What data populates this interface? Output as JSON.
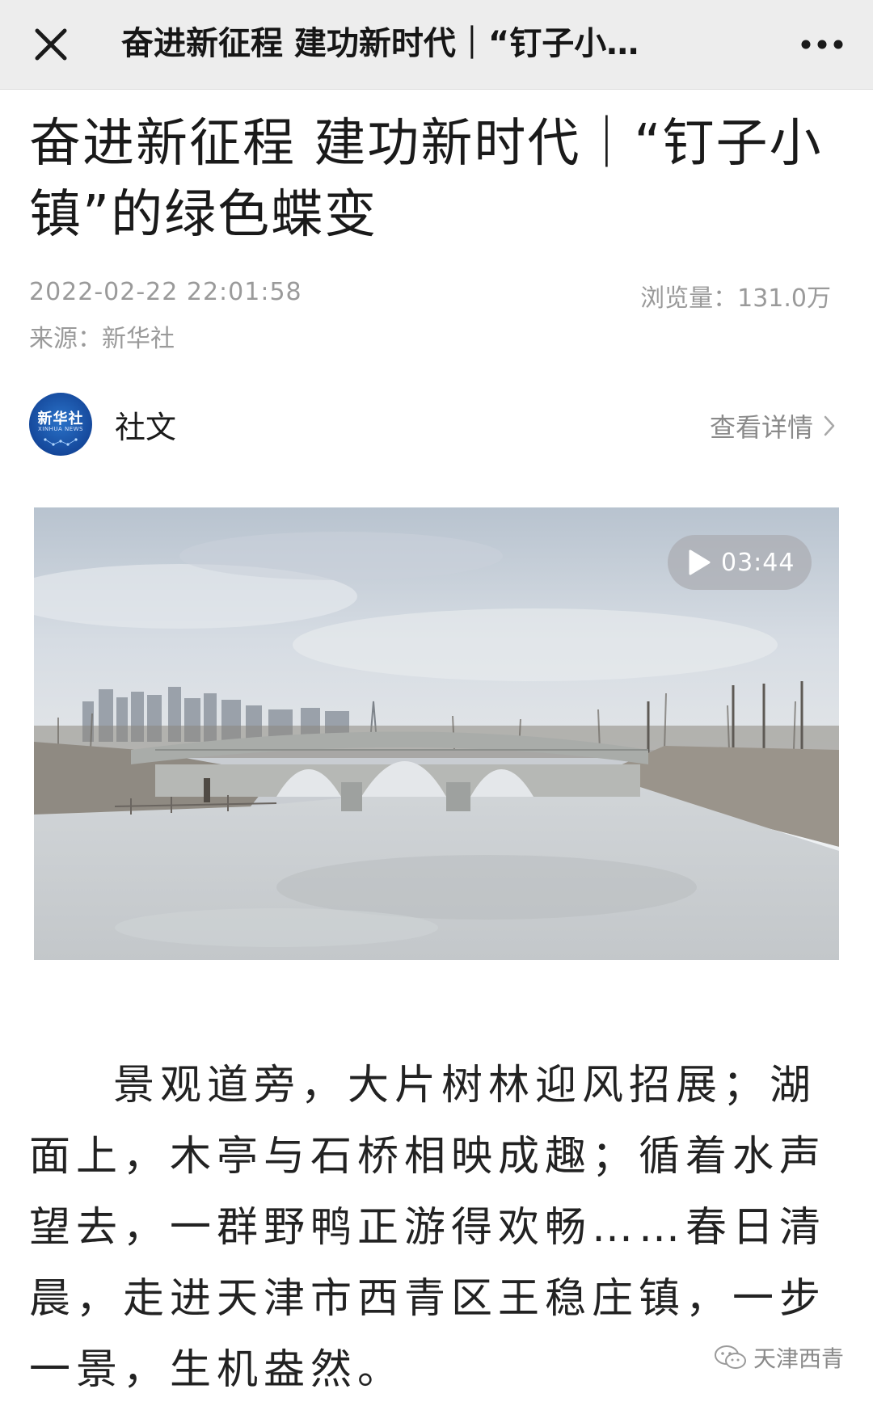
{
  "nav": {
    "title": "奋进新征程 建功新时代｜“钉子小…",
    "close_icon": "close-icon",
    "more_icon": "more-icon"
  },
  "article": {
    "title": "奋进新征程 建功新时代｜“钉子小镇”的绿色蝶变",
    "date": "2022-02-22 22:01:58",
    "views": "浏览量：131.0万",
    "source": "来源：新华社"
  },
  "account": {
    "avatar_text": "新华社",
    "avatar_sub": "XINHUA NEWS",
    "name": "社文",
    "detail_link": "查看详情"
  },
  "video": {
    "duration": "03:44",
    "play_icon": "play-icon"
  },
  "body": {
    "paragraph": "景观道旁，大片树林迎风招展；湖面上，木亭与石桥相映成趣；循着水声望去，一群野鸭正游得欢畅……春日清晨，走进天津市西青区王稳庄镇，一步一景，生机盎然。"
  },
  "watermark": {
    "text": "天津西青",
    "icon": "wechat-icon"
  }
}
